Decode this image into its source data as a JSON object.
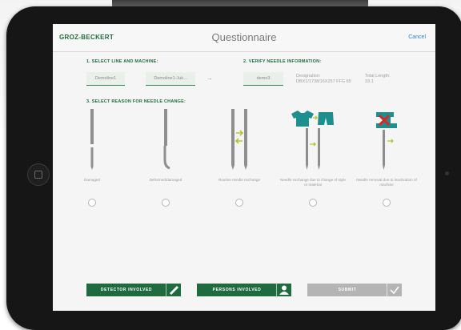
{
  "nav": {
    "brand": "GROZ-BECKERT",
    "title": "Questionnaire",
    "cancel_label": "Cancel"
  },
  "step1": {
    "heading": "1. SELECT LINE AND MACHINE:",
    "line_value": "Demoline1",
    "machine_value": "Demoline1-Juk..."
  },
  "step2": {
    "heading": "2. VERIFY NEEDLE INFORMATION:",
    "needle_value": "demo3",
    "designation_label": "Designation:",
    "designation_value": "DBX1/1738/16X257 FFG 65",
    "total_length_label": "Total Length:",
    "total_length_value": "33.1"
  },
  "step3": {
    "heading": "3. SELECT REASON FOR NEEDLE CHANGE:",
    "options": [
      {
        "caption": "Damaged",
        "icon": "broken-needle-icon"
      },
      {
        "caption": "Deformed/damaged",
        "icon": "bent-needle-icon"
      },
      {
        "caption": "Routine needle exchange",
        "icon": "needle-exchange-icon"
      },
      {
        "caption": "Needle exchange due to change of style or material",
        "icon": "garment-needle-exchange-icon"
      },
      {
        "caption": "Needle removal due to inactivation of machine",
        "icon": "machine-inactive-needle-icon"
      }
    ]
  },
  "actions": {
    "detector_label": "DETECTOR INVOLVED",
    "persons_label": "PERSONS INVOLVED",
    "submit_label": "SUBMIT"
  },
  "colors": {
    "brand_green": "#1e6b3a",
    "button_green": "#1f6b3f",
    "submit_gray": "#b4b4b4",
    "link_blue": "#2f83d6",
    "shirt_teal": "#1e8f8f",
    "alert_red": "#d9262b",
    "arrow_yellow": "#b8c52a"
  }
}
